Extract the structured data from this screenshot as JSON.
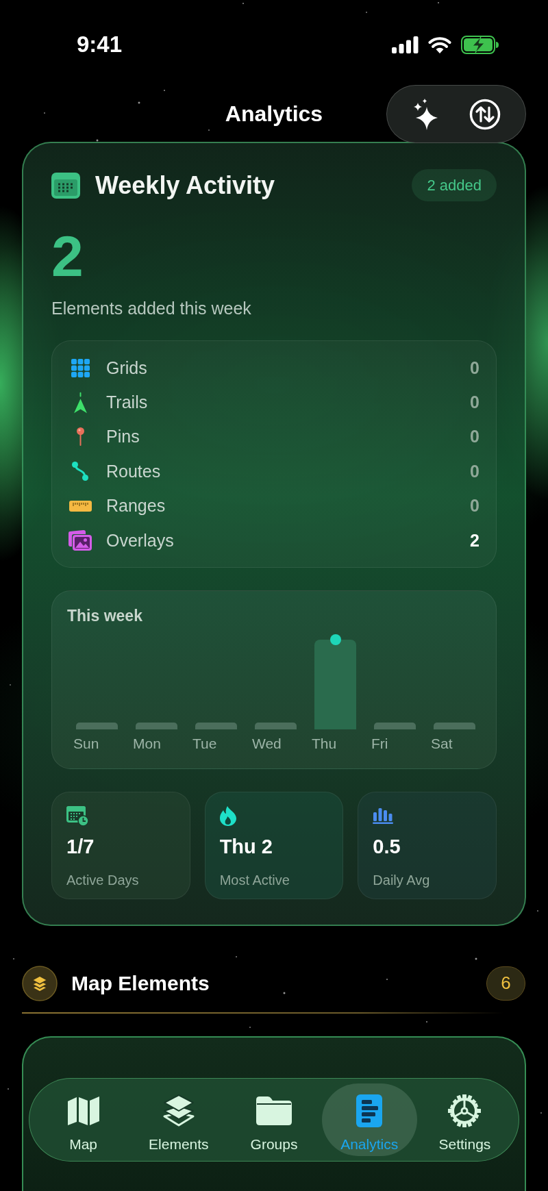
{
  "status_bar": {
    "time": "9:41"
  },
  "header": {
    "title": "Analytics"
  },
  "weekly_activity": {
    "title": "Weekly Activity",
    "badge": "2 added",
    "count": "2",
    "caption": "Elements added this week",
    "breakdown": [
      {
        "kind": "grids",
        "label": "Grids",
        "count": "0",
        "highlighted": false
      },
      {
        "kind": "trails",
        "label": "Trails",
        "count": "0",
        "highlighted": false
      },
      {
        "kind": "pins",
        "label": "Pins",
        "count": "0",
        "highlighted": false
      },
      {
        "kind": "routes",
        "label": "Routes",
        "count": "0",
        "highlighted": false
      },
      {
        "kind": "ranges",
        "label": "Ranges",
        "count": "0",
        "highlighted": false
      },
      {
        "kind": "overlays",
        "label": "Overlays",
        "count": "2",
        "highlighted": true
      }
    ],
    "chart": {
      "title": "This week",
      "days": [
        {
          "label": "Sun",
          "active": false
        },
        {
          "label": "Mon",
          "active": false
        },
        {
          "label": "Tue",
          "active": false
        },
        {
          "label": "Wed",
          "active": false
        },
        {
          "label": "Thu",
          "active": true
        },
        {
          "label": "Fri",
          "active": false
        },
        {
          "label": "Sat",
          "active": false
        }
      ]
    },
    "stats": [
      {
        "kind": "active_days",
        "value": "1/7",
        "label": "Active Days"
      },
      {
        "kind": "most_active",
        "value": "Thu 2",
        "label": "Most Active"
      },
      {
        "kind": "daily_avg",
        "value": "0.5",
        "label": "Daily Avg"
      }
    ]
  },
  "map_elements": {
    "title": "Map Elements",
    "count": "6"
  },
  "tabs": [
    {
      "kind": "map",
      "label": "Map",
      "selected": false
    },
    {
      "kind": "elements",
      "label": "Elements",
      "selected": false
    },
    {
      "kind": "groups",
      "label": "Groups",
      "selected": false
    },
    {
      "kind": "analytics",
      "label": "Analytics",
      "selected": true
    },
    {
      "kind": "settings",
      "label": "Settings",
      "selected": false
    }
  ]
}
